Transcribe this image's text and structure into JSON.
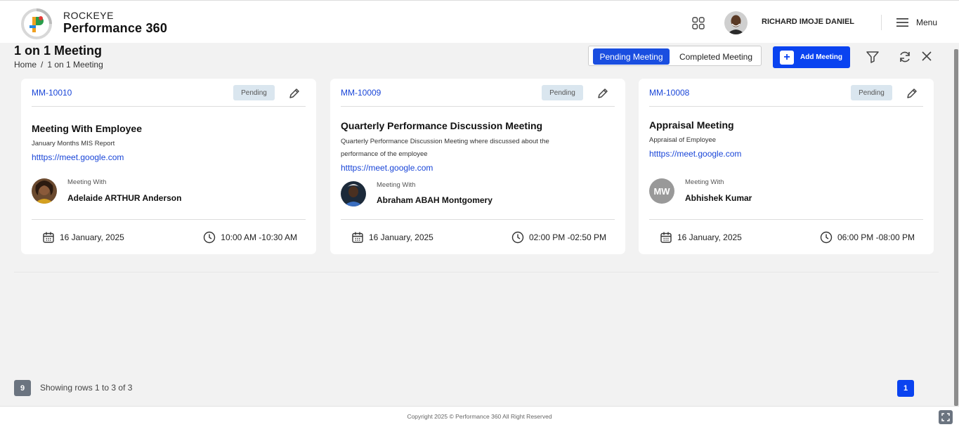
{
  "header": {
    "brand_small": "ROCKEYE",
    "brand_big": "Performance 360",
    "user_name": "RICHARD IMOJE DANIEL",
    "menu_label": "Menu"
  },
  "page": {
    "title": "1 on 1 Meeting",
    "breadcrumb": [
      "Home",
      "/",
      "1 on 1 Meeting"
    ]
  },
  "toolbar": {
    "pending_label": "Pending Meeting",
    "completed_label": "Completed Meeting",
    "add_label": "Add Meeting",
    "active_tab": "Pending Meeting",
    "accent_color": "#0a43f0"
  },
  "cards": [
    {
      "id": "MM-10010",
      "status": "Pending",
      "title": "Meeting With Employee",
      "description": "January Months MIS Report",
      "link": "htttps://meet.google.com",
      "meeting_with_label": "Meeting With",
      "meeting_with": "Adelaide ARTHUR Anderson",
      "date": "16 January, 2025",
      "time": "10:00 AM -10:30 AM"
    },
    {
      "id": "MM-10009",
      "status": "Pending",
      "title": "Quarterly Performance Discussion Meeting",
      "description": "Quarterly Performance Discussion Meeting where discussed about the performance of the employee",
      "link": "htttps://meet.google.com",
      "meeting_with_label": "Meeting With",
      "meeting_with": "Abraham ABAH Montgomery",
      "date": "16 January, 2025",
      "time": "02:00 PM -02:50 PM"
    },
    {
      "id": "MM-10008",
      "status": "Pending",
      "title": "Appraisal Meeting",
      "description": "Appraisal of Employee",
      "link": "htttps://meet.google.com",
      "meeting_with_label": "Meeting With",
      "meeting_with": "Abhishek Kumar",
      "avatar_initials": "MW",
      "date": "16 January, 2025",
      "time": "06:00 PM -08:00 PM"
    }
  ],
  "pagination": {
    "page_size": "9",
    "rows_info": "Showing rows 1 to 3 of 3",
    "current_page": "1"
  },
  "footer": {
    "copyright": "Copyright 2025 © Performance 360 All Right Reserved"
  }
}
